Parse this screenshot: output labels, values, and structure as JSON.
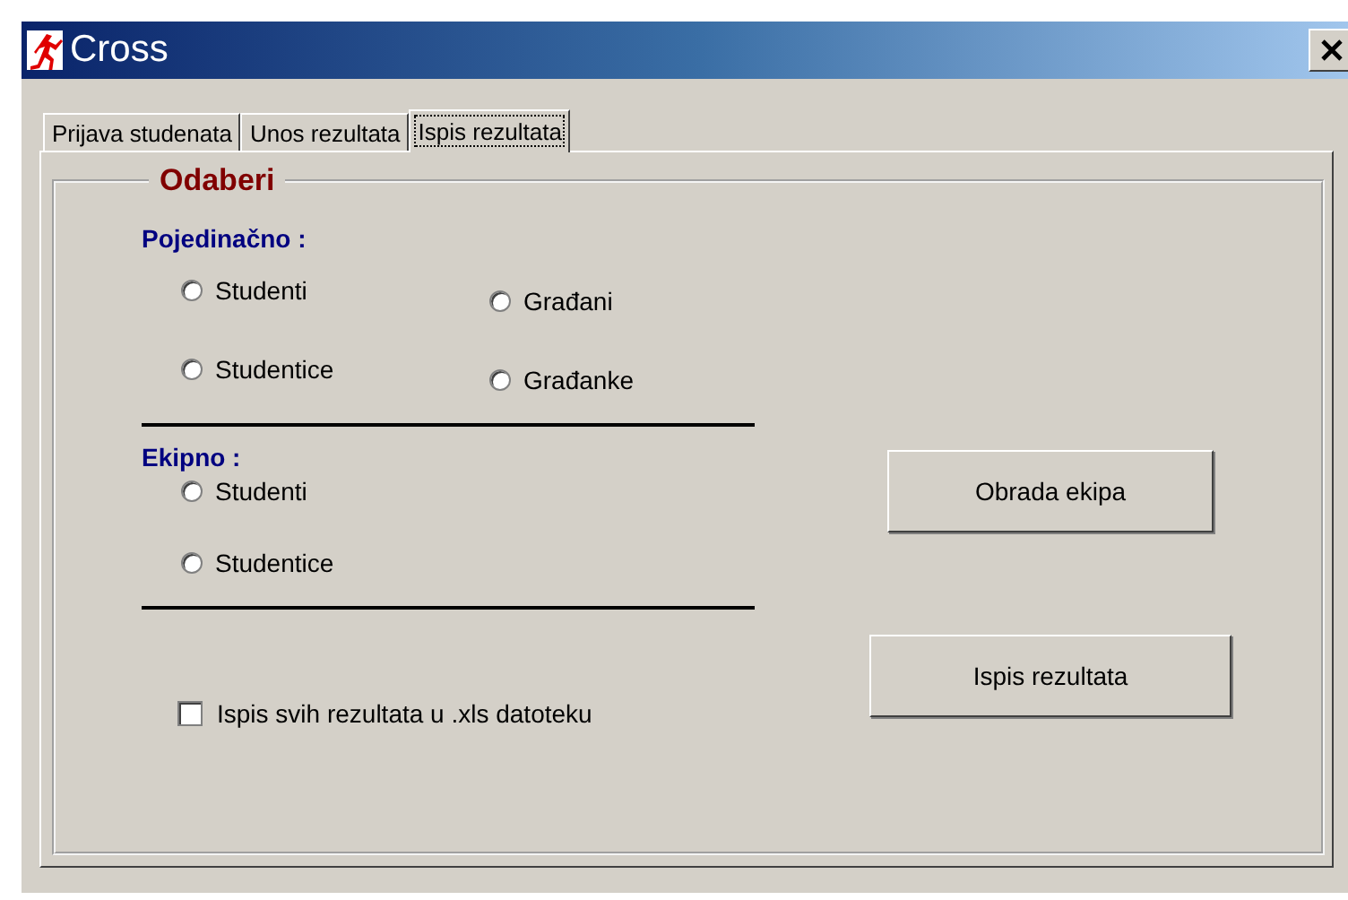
{
  "window": {
    "title": "Cross"
  },
  "tabs": [
    {
      "label": "Prijava studenata",
      "selected": false
    },
    {
      "label": "Unos rezultata",
      "selected": false
    },
    {
      "label": "Ispis rezultata",
      "selected": true
    }
  ],
  "group": {
    "title": "Odaberi",
    "individual": {
      "heading": "Pojedinačno :",
      "options": [
        {
          "label": "Studenti",
          "selected": false
        },
        {
          "label": "Građani",
          "selected": false
        },
        {
          "label": "Studentice",
          "selected": false
        },
        {
          "label": "Građanke",
          "selected": false
        }
      ]
    },
    "team": {
      "heading": "Ekipno :",
      "options": [
        {
          "label": "Studenti",
          "selected": false
        },
        {
          "label": "Studentice",
          "selected": false
        }
      ]
    },
    "export_checkbox": {
      "label": "Ispis svih rezultata u .xls datoteku",
      "checked": false
    },
    "buttons": [
      "Obrada ekipa",
      "Ispis rezultata"
    ]
  }
}
